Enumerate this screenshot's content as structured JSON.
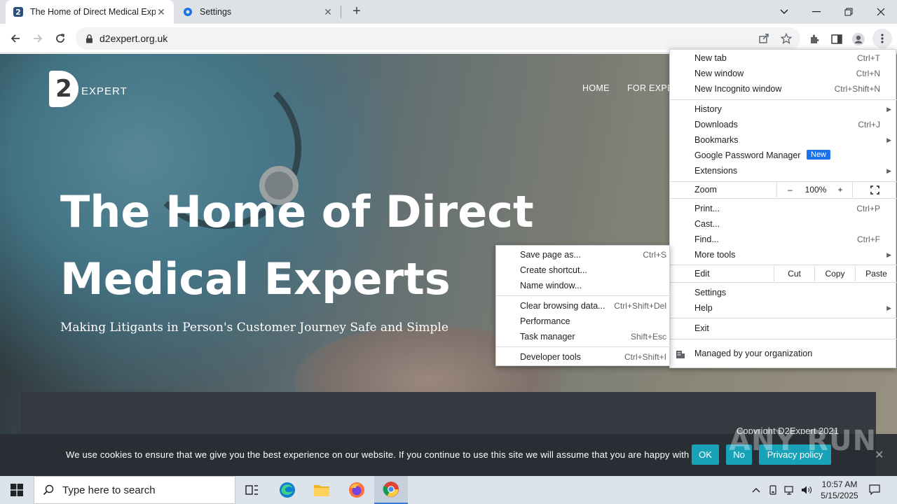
{
  "browser": {
    "tabs": [
      {
        "title": "The Home of Direct Medical Exp",
        "active": true
      },
      {
        "title": "Settings",
        "active": false
      }
    ],
    "url": "d2expert.org.uk",
    "accent": "#1a73e8"
  },
  "site": {
    "logo_letter": "2",
    "logo_word": "EXPERT",
    "nav": [
      "HOME",
      "FOR EXPER"
    ],
    "hero_title_line1": "The Home of Direct",
    "hero_title_line2": "Medical Experts",
    "hero_subtitle": "Making Litigants in Person's Customer Journey Safe and Simple",
    "copyright": "Copyright D2Expert 2021"
  },
  "cookie_bar": {
    "message": "We use cookies to ensure that we give you the best experience on our website. If you continue to use this site we will assume that you are happy with it.",
    "ok": "OK",
    "no": "No",
    "privacy": "Privacy policy",
    "button_color": "#17a2b8"
  },
  "watermark": "ANY RUN",
  "chrome_menu": {
    "new_tab": {
      "label": "New tab",
      "shortcut": "Ctrl+T"
    },
    "new_window": {
      "label": "New window",
      "shortcut": "Ctrl+N"
    },
    "new_incognito": {
      "label": "New Incognito window",
      "shortcut": "Ctrl+Shift+N"
    },
    "history": {
      "label": "History"
    },
    "downloads": {
      "label": "Downloads",
      "shortcut": "Ctrl+J"
    },
    "bookmarks": {
      "label": "Bookmarks"
    },
    "password_manager": {
      "label": "Google Password Manager",
      "badge": "New"
    },
    "extensions": {
      "label": "Extensions"
    },
    "zoom": {
      "label": "Zoom",
      "minus": "–",
      "value": "100%",
      "plus": "+"
    },
    "print": {
      "label": "Print...",
      "shortcut": "Ctrl+P"
    },
    "cast": {
      "label": "Cast..."
    },
    "find": {
      "label": "Find...",
      "shortcut": "Ctrl+F"
    },
    "more_tools": {
      "label": "More tools"
    },
    "edit": {
      "label": "Edit",
      "cut": "Cut",
      "copy": "Copy",
      "paste": "Paste"
    },
    "settings": {
      "label": "Settings"
    },
    "help": {
      "label": "Help"
    },
    "exit": {
      "label": "Exit"
    },
    "managed": {
      "label": "Managed by your organization"
    }
  },
  "more_tools_menu": {
    "save_page": {
      "label": "Save page as...",
      "shortcut": "Ctrl+S"
    },
    "create_shortcut": {
      "label": "Create shortcut..."
    },
    "name_window": {
      "label": "Name window..."
    },
    "clear_data": {
      "label": "Clear browsing data...",
      "shortcut": "Ctrl+Shift+Del"
    },
    "performance": {
      "label": "Performance"
    },
    "task_manager": {
      "label": "Task manager",
      "shortcut": "Shift+Esc"
    },
    "dev_tools": {
      "label": "Developer tools",
      "shortcut": "Ctrl+Shift+I"
    }
  },
  "taskbar": {
    "search_placeholder": "Type here to search",
    "time": "10:57 AM",
    "date": "5/15/2025"
  }
}
